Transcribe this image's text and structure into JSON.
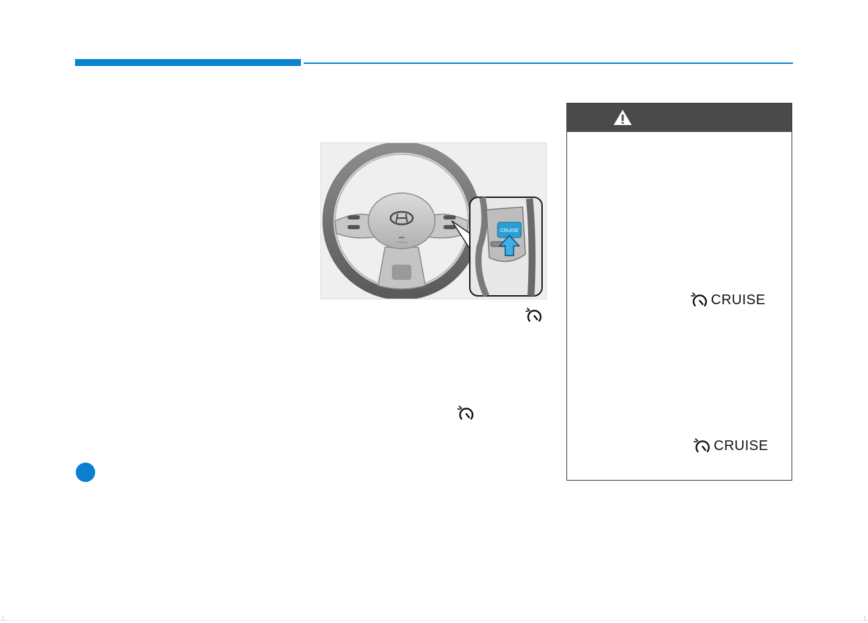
{
  "colors": {
    "accent": "#0a82d2",
    "warning_header": "#4a4a4a",
    "cruise_highlight": "#2a9fd6"
  },
  "figure": {
    "cruise_button_label": "CRUISE"
  },
  "icons": {
    "cruise_control": "cruise-speedometer-icon",
    "warning": "warning-triangle-icon"
  },
  "warning_box": {
    "cruise_indicator_1": "CRUISE",
    "cruise_indicator_2": "CRUISE"
  }
}
